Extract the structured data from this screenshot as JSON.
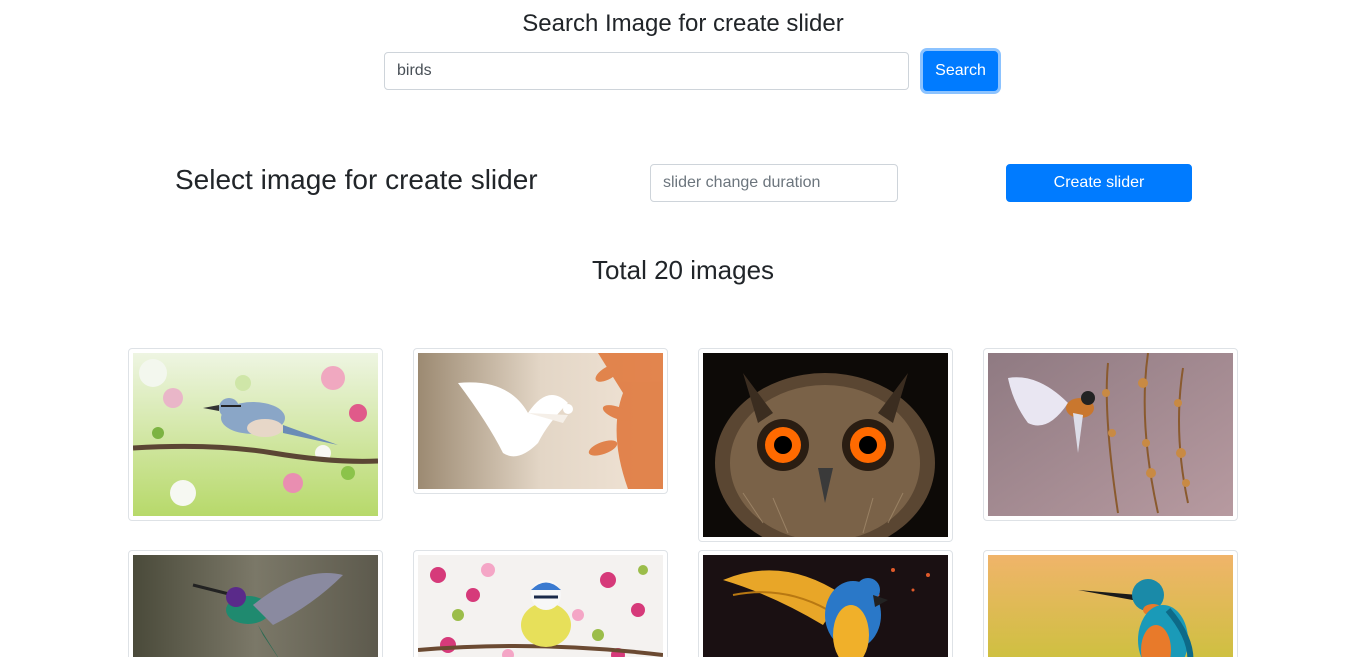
{
  "search": {
    "title": "Search Image for create slider",
    "value": "birds",
    "button_label": "Search"
  },
  "slider": {
    "title": "Select image for create slider",
    "duration_placeholder": "slider change duration",
    "create_label": "Create slider"
  },
  "gallery": {
    "total_label": "Total 20 images",
    "images": [
      {
        "subject": "nuthatch on blossom branch"
      },
      {
        "subject": "white dove flying"
      },
      {
        "subject": "eagle owl face"
      },
      {
        "subject": "small bird in flight near dry branches"
      },
      {
        "subject": "hummingbird"
      },
      {
        "subject": "blue tit among pink blossoms"
      },
      {
        "subject": "macaw with spread wings"
      },
      {
        "subject": "kingfisher"
      }
    ]
  },
  "colors": {
    "primary": "#007bff",
    "text": "#212529",
    "border": "#ced4da"
  }
}
